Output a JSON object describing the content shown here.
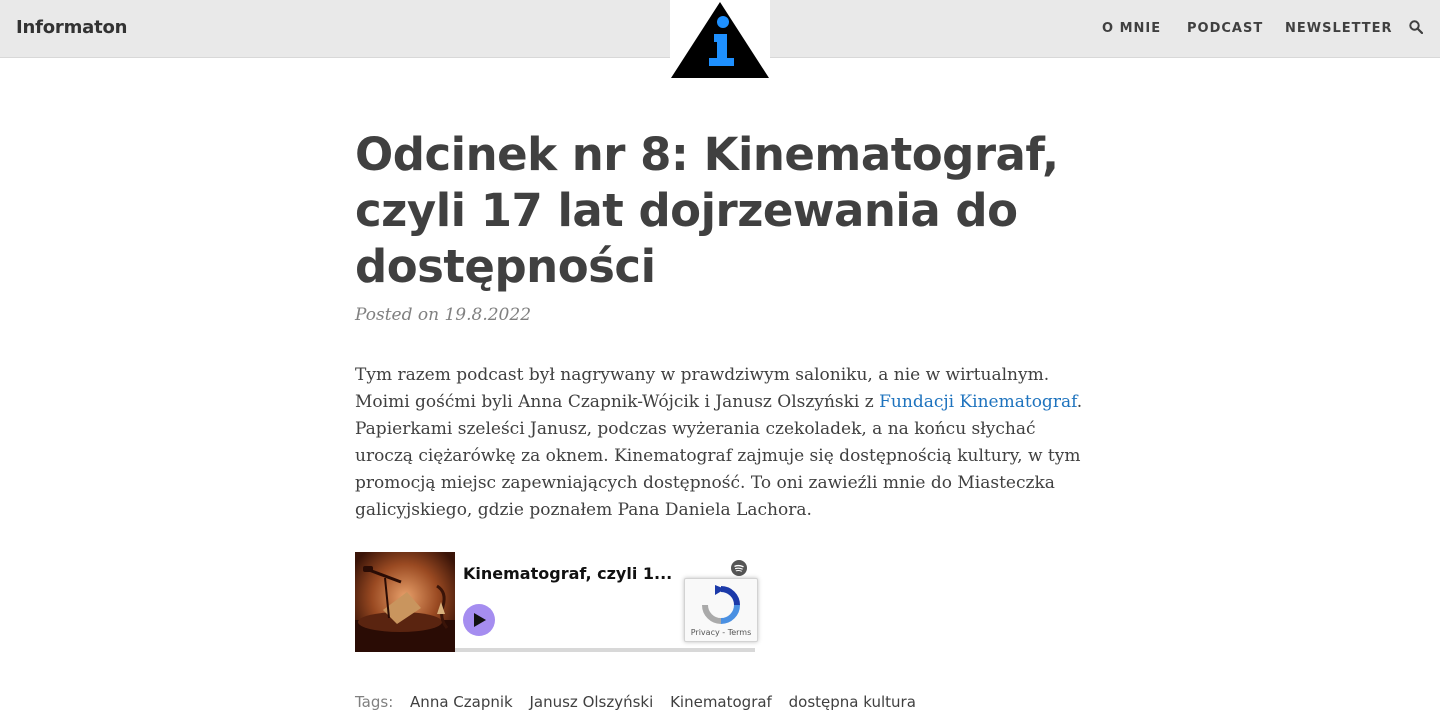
{
  "site": {
    "name": "Informaton"
  },
  "nav": {
    "items": [
      {
        "label": "O MNIE"
      },
      {
        "label": "PODCAST"
      },
      {
        "label": "NEWSLETTER"
      }
    ],
    "search_icon": "search-icon"
  },
  "post": {
    "title": "Odcinek nr 8: Kinematograf, czyli 17 lat dojrzewania do dostępności",
    "meta_prefix": "Posted on",
    "date": "19.8.2022",
    "body_before_link": "Tym razem podcast był nagrywany w prawdziwym saloniku, a nie w wirtualnym. Moimi gośćmi byli Anna Czapnik-Wójcik i Janusz Olszyński z ",
    "link_text": "Fundacji Kinematograf",
    "body_after_link": ". Papierkami szeleści Janusz, podczas wyżerania czekoladek, a na końcu słychać uroczą ciężarówkę za oknem. Kinematograf zajmuje się dostępnością kultury, w tym promocją miejsc zapewniających dostępność. To oni zawieźli mnie do Miasteczka galicyjskiego, gdzie poznałem Pana Daniela Lachora."
  },
  "embed": {
    "episode_title": "Kinematograf, czyli 1...",
    "spotify_icon": "spotify-icon",
    "play_icon": "play-icon"
  },
  "recaptcha": {
    "privacy": "Privacy",
    "separator": " - ",
    "terms": "Terms"
  },
  "tags": {
    "label": "Tags:",
    "items": [
      "Anna Czapnik",
      "Janusz Olszyński",
      "Kinematograf",
      "dostępna kultura"
    ]
  },
  "colors": {
    "header_bg": "#e9e9e9",
    "text": "#404040",
    "link": "#1e73be",
    "logo_blue": "#1e90ff",
    "play_button": "#a58df0"
  }
}
